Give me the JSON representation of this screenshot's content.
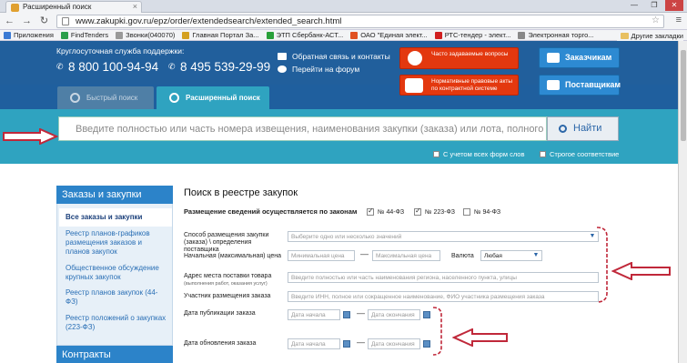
{
  "browser": {
    "tab_title": "Расширенный поиск",
    "tab_close": "×",
    "win_min": "—",
    "win_max": "❐",
    "win_close": "✕",
    "back": "←",
    "forward": "→",
    "reload": "↻",
    "url": "www.zakupki.gov.ru/epz/order/extendedsearch/extended_search.html",
    "star": "☆",
    "menu": "≡",
    "bookmarks": [
      {
        "label": "Приложения",
        "color": "#3b7bd4"
      },
      {
        "label": "FindTenders",
        "color": "#2a9e4a"
      },
      {
        "label": "Звонки(040070)",
        "color": "#999999"
      },
      {
        "label": "Главная Портал За...",
        "color": "#d4a020"
      },
      {
        "label": "ЭТП Сбербанк-АСТ...",
        "color": "#29a03a"
      },
      {
        "label": "ОАО \"Единая элект...",
        "color": "#e05020"
      },
      {
        "label": "РТС-тендер - элект...",
        "color": "#d02020"
      },
      {
        "label": "Электронная торго...",
        "color": "#888888"
      }
    ],
    "other_bookmarks": "Другие закладки"
  },
  "header": {
    "support_label": "Круглосуточная служба поддержки:",
    "phone_1": "8 800 100-94-94",
    "phone_2": "8 495 539-29-99",
    "feedback_link": "Обратная связь и контакты",
    "forum_link": "Перейти на форум",
    "faq_button": "Часто задаваемые вопросы",
    "legal_button": "Нормативные правовые акты по контрактной системе",
    "customers_button": "Заказчикам",
    "suppliers_button": "Поставщикам"
  },
  "search": {
    "tab_quick": "Быстрый поиск",
    "tab_extended": "Расширенный поиск",
    "placeholder": "Введите полностью или часть номера извещения, наименования закупки (заказа) или лота, полного наи...",
    "find_button": "Найти",
    "all_word_forms": "С учетом всех форм слов",
    "strict_match": "Строгое соответствие"
  },
  "sidebar": {
    "section_orders": "Заказы и закупки",
    "items": [
      "Все заказы и закупки",
      "Реестр планов-графиков размещения заказов и планов закупок",
      "Общественное обсуждение крупных закупок",
      "Реестр планов закупок (44-ФЗ)",
      "Реестр положений о закупках (223-ФЗ)"
    ],
    "section_contracts": "Контракты"
  },
  "form": {
    "title": "Поиск в реестре закупок",
    "law_label": "Размещение сведений осуществляется по законам",
    "laws": [
      {
        "label": "№ 44-ФЗ",
        "checked": true
      },
      {
        "label": "№ 223-ФЗ",
        "checked": true
      },
      {
        "label": "№ 94-ФЗ",
        "checked": false
      }
    ],
    "method_label": "Способ размещения закупки (заказа) \\ определения поставщика",
    "method_placeholder": "Выберите одно или несколько значений",
    "price_label": "Начальная (максимальная) цена",
    "price_min": "Минимальная цена",
    "price_max": "Максимальная цена",
    "price_dash": "—",
    "currency_label": "Валюта",
    "currency_value": "Любая",
    "address_label": "Адрес места поставки товара",
    "address_sublabel": "(выполнения работ, оказания услуг)",
    "address_placeholder": "Введите полностью или часть наименования региона, населенного пункта, улицы",
    "participant_label": "Участник размещения заказа",
    "participant_placeholder": "Введите ИНН, полное или сокращенное наименование, ФИО участника размещения заказа",
    "pub_date_label": "Дата публикации заказа",
    "upd_date_label": "Дата обновления заказа",
    "date_start": "Дата начала",
    "date_end": "Дата окончания",
    "date_dash": "—"
  },
  "colors": {
    "header_blue": "#215f9c",
    "search_teal": "#2fa3c0",
    "annotation_red": "#c0283a"
  }
}
